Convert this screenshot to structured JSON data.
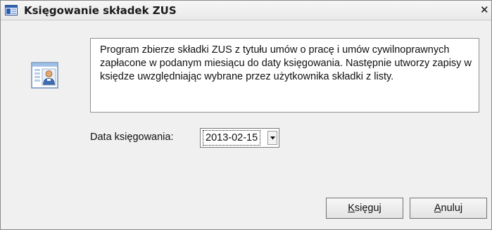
{
  "window": {
    "title": "Księgowanie składek ZUS",
    "close_glyph": "✕",
    "icon": "app-window-icon"
  },
  "info": {
    "icon": "user-card-icon",
    "text": "Program zbierze składki ZUS z tytułu umów o pracę i umów cywilnoprawnych zapłacone w podanym miesiącu do daty księgowania. Następnie utworzy zapisy w księdze uwzględniając wybrane przez użytkownika składki z listy."
  },
  "date": {
    "label": "Data księgowania:",
    "value": "2013-02-15",
    "dropdown_icon": "chevron-down-icon"
  },
  "buttons": {
    "ksieguj": {
      "mnemonic": "K",
      "rest": "sięguj"
    },
    "anuluj": {
      "mnemonic": "A",
      "rest": "nuluj"
    }
  },
  "colors": {
    "dialog_bg": "#f0f0f0",
    "info_bg": "#ffffff",
    "border": "#8f8f8f"
  }
}
